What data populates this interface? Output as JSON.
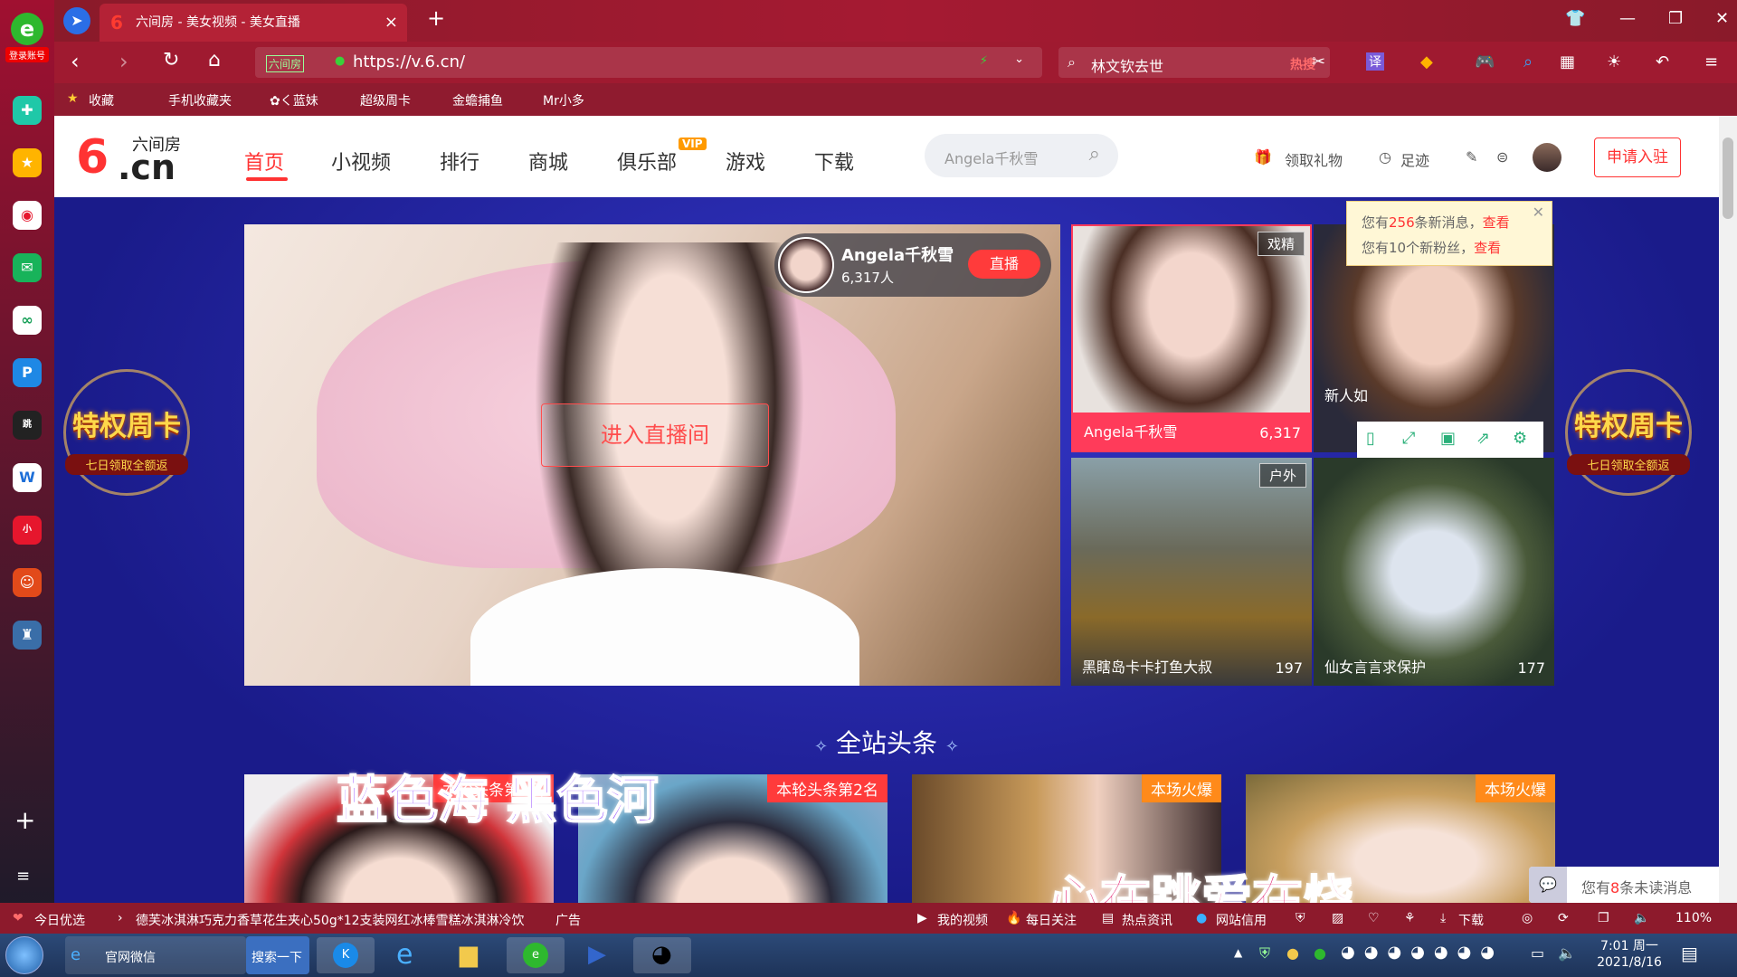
{
  "browser": {
    "login_label": "登录账号",
    "tab_title": "六间房 - 美女视频 - 美女直播",
    "tab_favicon": "6",
    "url": "https://v.6.cn/",
    "security_tag": "六间房",
    "search_query": "林文钦去世",
    "search_hot": "热搜",
    "bookmarks": [
      "收藏",
      "手机收藏夹",
      "✿く蓝妹",
      "超级周卡",
      "金蟾捕鱼",
      "Mr小多"
    ]
  },
  "site": {
    "logo_six": "6",
    "logo_cn": ".cn",
    "logo_sub": "六间房",
    "nav": [
      "首页",
      "小视频",
      "排行",
      "商城",
      "俱乐部",
      "游戏",
      "下载"
    ],
    "vip_badge": "VIP",
    "search_placeholder": "Angela千秋雪",
    "gift_label": "领取礼物",
    "footprint_label": "足迹",
    "apply_label": "申请入驻"
  },
  "promo": {
    "title": "特权周卡",
    "subtitle": "七日领取全额返"
  },
  "main_live": {
    "name": "Angela千秋雪",
    "viewers": "6,317人",
    "live_badge": "直播",
    "enter_label": "进入直播间"
  },
  "notification": {
    "line1_pre": "您有",
    "line1_num": "256",
    "line1_mid": "条新消息，",
    "line1_link": "查看",
    "line2_pre": "您有10个新粉丝，",
    "line2_link": "查看"
  },
  "thumbs": [
    {
      "tag": "戏精",
      "name": "Angela千秋雪",
      "count": "6,317"
    },
    {
      "tag": "",
      "name": "新人如",
      "count": ""
    },
    {
      "tag": "户外",
      "name": "黑瞎岛卡卡打鱼大叔",
      "count": "197"
    },
    {
      "tag": "",
      "name": "仙女言言求保护",
      "count": "177"
    }
  ],
  "section": {
    "title": "全站头条"
  },
  "cards": [
    {
      "badge": "本轮头条第1名"
    },
    {
      "badge": "本轮头条第2名"
    },
    {
      "badge": "本场火爆"
    },
    {
      "badge": "本场火爆"
    }
  ],
  "lyrics": {
    "line1": "蓝色海 黑色河",
    "line2": "心在跳爱在烧"
  },
  "chat_popup": {
    "pre": "您有",
    "num": "8",
    "post": "条未读消息"
  },
  "statusbar": {
    "today": "今日优选",
    "ad": "德芙冰淇淋巧克力香草花生夹心50g*12支装网红冰棒雪糕冰淇淋冷饮",
    "ad_tag": "广告",
    "my_video": "我的视频",
    "daily": "每日关注",
    "hot_news": "热点资讯",
    "site_trust": "网站信用",
    "download": "下载",
    "zoom": "110%"
  },
  "taskbar": {
    "ie_label": "官网微信",
    "search_btn": "搜索一下",
    "time": "7:01 周一",
    "date": "2021/8/16"
  },
  "colors": {
    "brand_red": "#ff3333",
    "browser_bar": "#a01a30",
    "site_bg": "#1c2090"
  }
}
